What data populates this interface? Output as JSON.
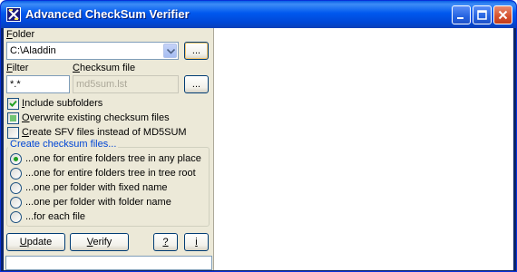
{
  "window": {
    "title": "Advanced CheckSum Verifier",
    "colors": {
      "titlebar": "#0058ee",
      "close": "#d5502c",
      "face": "#ece9d8",
      "group_title": "#0046d5",
      "check_green": "#21a121"
    }
  },
  "folder": {
    "label_mnemonic": "F",
    "label_rest": "older",
    "value": "C:\\Aladdin",
    "browse_label": "..."
  },
  "filter": {
    "label_mnemonic": "F",
    "label_rest": "ilter",
    "value": "*.*"
  },
  "checksum_file": {
    "label_mnemonic": "C",
    "label_rest": "hecksum file",
    "value": "md5sum.lst",
    "browse_label": "..."
  },
  "options": {
    "include_subfolders": {
      "mnemonic": "I",
      "rest": "nclude subfolders",
      "state": "checked"
    },
    "overwrite": {
      "mnemonic": "O",
      "rest": "verwrite existing checksum files",
      "state": "indeterminate"
    },
    "create_sfv": {
      "mnemonic": "C",
      "rest": "reate SFV files instead of MD5SUM",
      "state": "unchecked"
    }
  },
  "create_group": {
    "title": "Create checksum files...",
    "radios": [
      {
        "label": "...one for entire folders tree in any place",
        "selected": true
      },
      {
        "label": "...one for entire folders tree in tree root",
        "selected": false
      },
      {
        "label": "...one per folder with fixed name",
        "selected": false
      },
      {
        "label": "...one per folder with folder name",
        "selected": false
      },
      {
        "label": "...for each file",
        "selected": false
      }
    ]
  },
  "buttons": {
    "update_mnemonic": "U",
    "update_rest": "pdate",
    "verify_mnemonic": "V",
    "verify_rest": "erify",
    "help_label": "?",
    "info_label": "i"
  }
}
